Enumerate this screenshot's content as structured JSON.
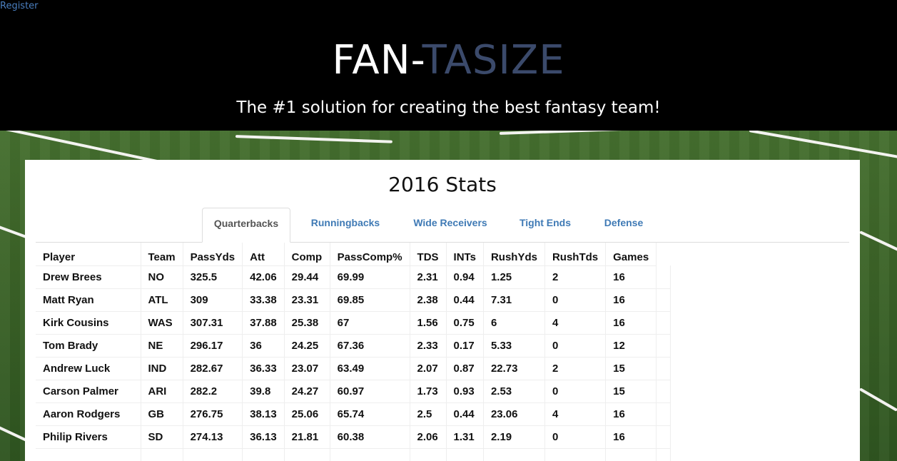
{
  "header": {
    "register_link": "Register",
    "brand_part1": "FAN-",
    "brand_part2": "TASIZE",
    "tagline": "The #1 solution for creating the best fantasy team!"
  },
  "panel": {
    "title": "2016 Stats",
    "tabs": [
      {
        "label": "Quarterbacks",
        "active": true
      },
      {
        "label": "Runningbacks",
        "active": false
      },
      {
        "label": "Wide Receivers",
        "active": false
      },
      {
        "label": "Tight Ends",
        "active": false
      },
      {
        "label": "Defense",
        "active": false
      }
    ]
  },
  "table": {
    "columns": [
      "Player",
      "Team",
      "PassYds",
      "Att",
      "Comp",
      "PassComp%",
      "TDS",
      "INTs",
      "RushYds",
      "RushTds",
      "Games"
    ],
    "rows": [
      [
        "Drew Brees",
        "NO",
        "325.5",
        "42.06",
        "29.44",
        "69.99",
        "2.31",
        "0.94",
        "1.25",
        "2",
        "16"
      ],
      [
        "Matt Ryan",
        "ATL",
        "309",
        "33.38",
        "23.31",
        "69.85",
        "2.38",
        "0.44",
        "7.31",
        "0",
        "16"
      ],
      [
        "Kirk Cousins",
        "WAS",
        "307.31",
        "37.88",
        "25.38",
        "67",
        "1.56",
        "0.75",
        "6",
        "4",
        "16"
      ],
      [
        "Tom Brady",
        "NE",
        "296.17",
        "36",
        "24.25",
        "67.36",
        "2.33",
        "0.17",
        "5.33",
        "0",
        "12"
      ],
      [
        "Andrew Luck",
        "IND",
        "282.67",
        "36.33",
        "23.07",
        "63.49",
        "2.07",
        "0.87",
        "22.73",
        "2",
        "15"
      ],
      [
        "Carson Palmer",
        "ARI",
        "282.2",
        "39.8",
        "24.27",
        "60.97",
        "1.73",
        "0.93",
        "2.53",
        "0",
        "15"
      ],
      [
        "Aaron Rodgers",
        "GB",
        "276.75",
        "38.13",
        "25.06",
        "65.74",
        "2.5",
        "0.44",
        "23.06",
        "4",
        "16"
      ],
      [
        "Philip Rivers",
        "SD",
        "274.13",
        "36.13",
        "21.81",
        "60.38",
        "2.06",
        "1.31",
        "2.19",
        "0",
        "16"
      ]
    ]
  },
  "colors": {
    "header_bg": "#000000",
    "brand_accent": "#3b4a6b",
    "link": "#3f7ab5",
    "field_green": "#3f6b2a"
  }
}
